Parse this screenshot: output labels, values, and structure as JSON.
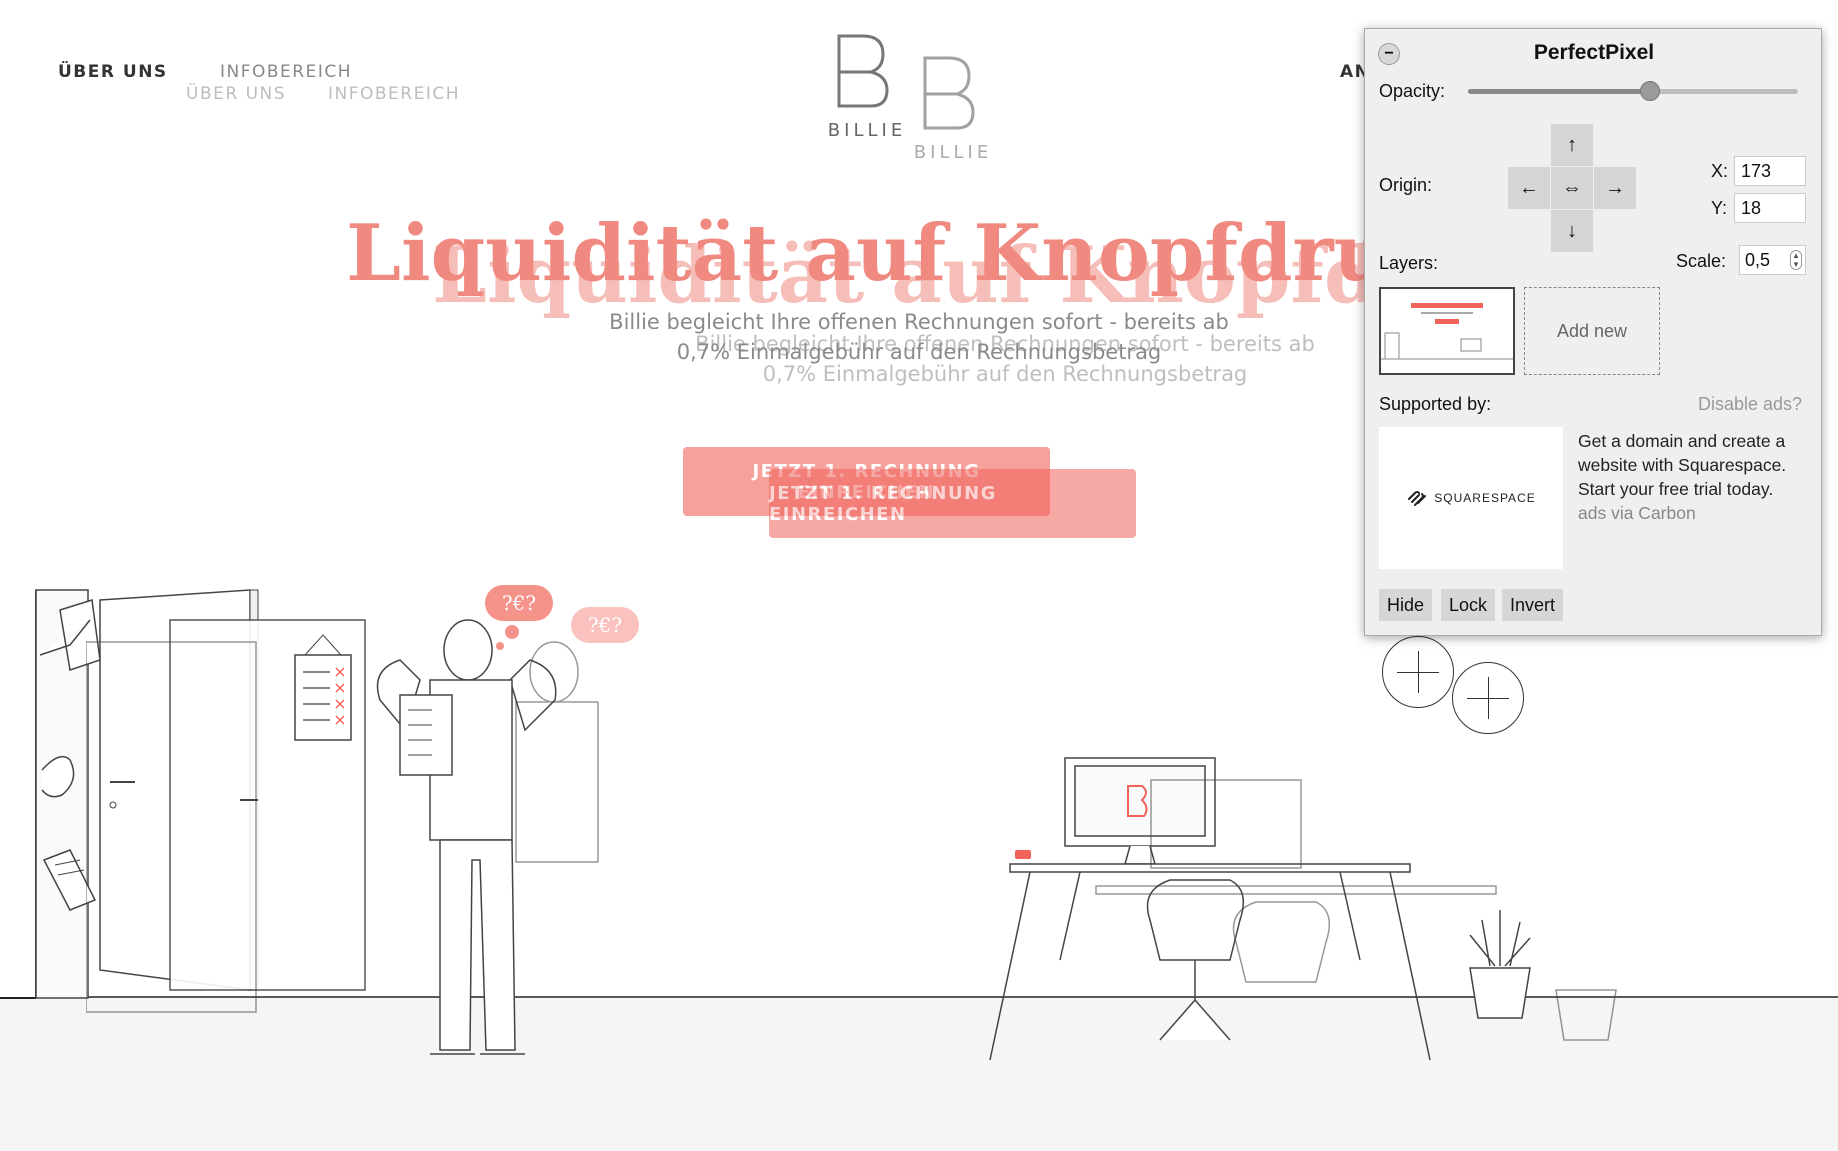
{
  "site": {
    "nav": {
      "about": "ÜBER UNS",
      "info": "INFOBEREICH",
      "right_cut": "AN"
    },
    "logo_text": "BILLIE",
    "headline": "Liquidität auf Knopfdruck",
    "subline_1": "Billie begleicht Ihre offenen Rechnungen sofort - bereits ab",
    "subline_2": "0,7% Einmalgebühr auf den Rechnungsbetrag",
    "cta_label": "JETZT 1. RECHNUNG EINREICHEN",
    "speech_bubble": "?€?",
    "accent_color": "#f0625a"
  },
  "panel": {
    "title": "PerfectPixel",
    "collapse": "−",
    "opacity_label": "Opacity:",
    "opacity_value": 0.55,
    "origin_label": "Origin:",
    "arrows": {
      "up": "↑",
      "down": "↓",
      "left": "←",
      "right": "→",
      "center": "⇔"
    },
    "x_label": "X:",
    "x_value": "173",
    "y_label": "Y:",
    "y_value": "18",
    "layers_label": "Layers:",
    "scale_label": "Scale:",
    "scale_value": "0,5",
    "add_new": "Add new",
    "supported_by": "Supported by:",
    "disable_ads": "Disable ads?",
    "ad_brand": "SQUARESPACE",
    "ad_text": "Get a domain and create a website with Squarespace. Start your free trial today.",
    "ad_via": "ads via Carbon",
    "buttons": {
      "hide": "Hide",
      "lock": "Lock",
      "invert": "Invert"
    }
  }
}
